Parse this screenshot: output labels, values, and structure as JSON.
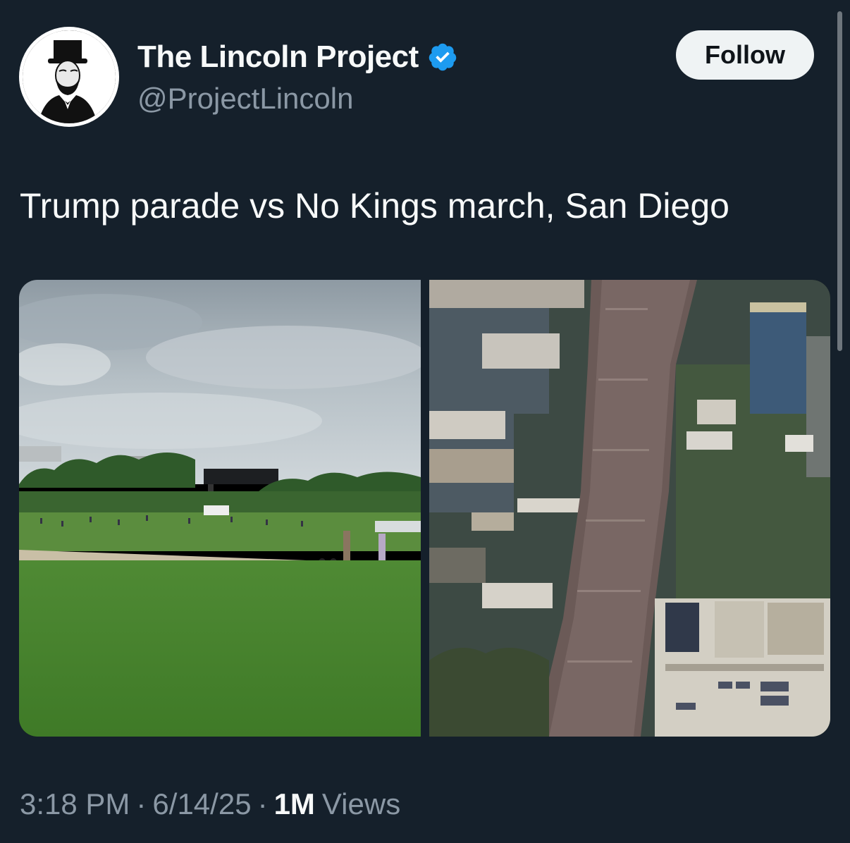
{
  "author": {
    "name": "The Lincoln Project",
    "handle": "@ProjectLincoln",
    "avatar_icon": "lincoln-portrait-icon",
    "verified_icon": "verified-badge-icon",
    "verified_color": "#1d9bf0"
  },
  "follow_button": {
    "label": "Follow"
  },
  "tweet": {
    "text": "Trump parade vs No Kings march, San Diego"
  },
  "media": {
    "images": [
      {
        "name": "photo-mall-sparse-crowd"
      },
      {
        "name": "photo-aerial-dense-march"
      }
    ]
  },
  "meta": {
    "time": "3:18 PM",
    "separator": "·",
    "date": "6/14/25",
    "views_count": "1M",
    "views_label": "Views"
  },
  "colors": {
    "background": "#15202b",
    "primary_text": "#f7f9f9",
    "secondary_text": "#8b98a5",
    "follow_bg": "#eff3f4"
  }
}
